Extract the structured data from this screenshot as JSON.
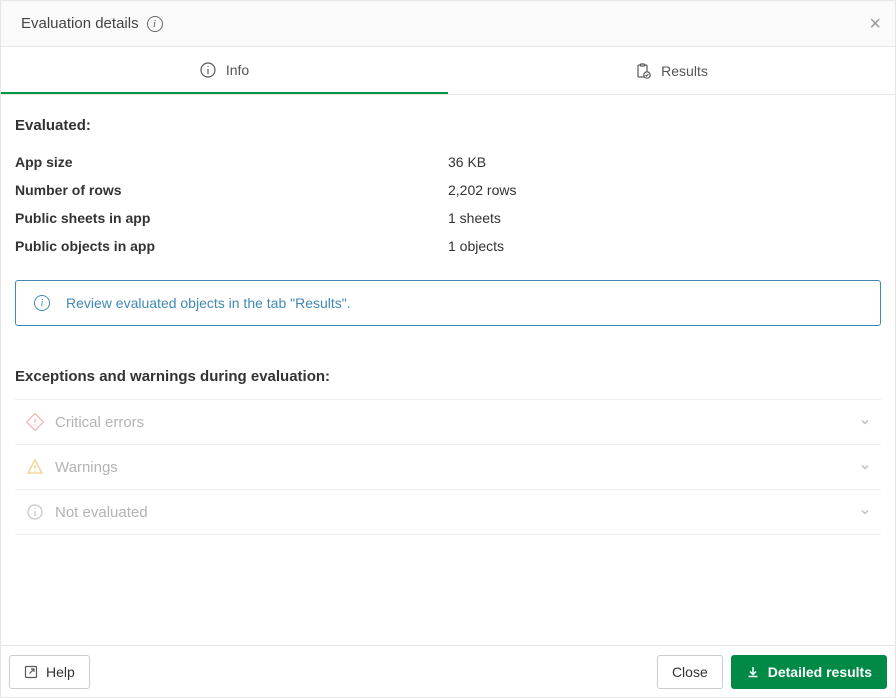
{
  "header": {
    "title": "Evaluation details"
  },
  "tabs": {
    "info": "Info",
    "results": "Results",
    "active": "info"
  },
  "sections": {
    "evaluated_heading": "Evaluated:",
    "exceptions_heading": "Exceptions and warnings during evaluation:"
  },
  "props": [
    {
      "label": "App size",
      "value": "36 KB"
    },
    {
      "label": "Number of rows",
      "value": "2,202 rows"
    },
    {
      "label": "Public sheets in app",
      "value": "1 sheets"
    },
    {
      "label": "Public objects in app",
      "value": "1 objects"
    }
  ],
  "banner": {
    "text": "Review evaluated objects in the tab \"Results\"."
  },
  "exceptions": [
    {
      "id": "critical",
      "label": "Critical errors"
    },
    {
      "id": "warnings",
      "label": "Warnings"
    },
    {
      "id": "not-evaluated",
      "label": "Not evaluated"
    }
  ],
  "footer": {
    "help": "Help",
    "close": "Close",
    "detailed": "Detailed results"
  },
  "colors": {
    "primary_green": "#008a46",
    "info_blue": "#3f8ab3",
    "muted": "#b3b3b3"
  }
}
